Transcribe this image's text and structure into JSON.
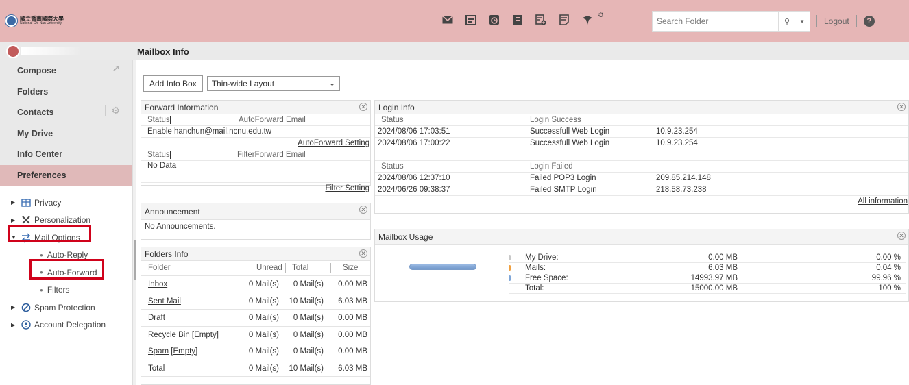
{
  "brand": {
    "logo_text_zh": "國立暨南國際大學",
    "logo_text_en": "National Chi Nan University"
  },
  "header": {
    "icons": [
      "mail-icon",
      "calendar-icon",
      "clock-icon",
      "address-book-icon",
      "add-note-icon",
      "notes-icon",
      "pin-icon",
      "settings-icon"
    ],
    "search_placeholder": "Search Folder",
    "logout_label": "Logout",
    "help_label": "?"
  },
  "page_title": "Mailbox Info",
  "sidebar": {
    "nav": [
      {
        "label": "Compose"
      },
      {
        "label": "Folders"
      },
      {
        "label": "Contacts"
      },
      {
        "label": "My Drive"
      },
      {
        "label": "Info Center"
      },
      {
        "label": "Preferences"
      }
    ],
    "tree": [
      {
        "label": "Privacy"
      },
      {
        "label": "Personalization"
      },
      {
        "label": "Mail Options"
      },
      {
        "label": "Spam Protection"
      },
      {
        "label": "Account Delegation"
      }
    ],
    "mail_options_sub": [
      "Auto-Reply",
      "Auto-Forward",
      "Filters"
    ]
  },
  "toolbar": {
    "add_info_box": "Add Info Box",
    "layout_value": "Thin-wide Layout"
  },
  "forward_info": {
    "title": "Forward Information",
    "status_label": "Status",
    "autoforward_header": "AutoForward Email",
    "autoforward_value": "Enable hanchun@mail.ncnu.edu.tw",
    "autoforward_setting": "AutoForward Setting",
    "filterforward_header": "FilterForward Email",
    "filter_value": "No Data",
    "filter_setting": "Filter Setting"
  },
  "announcement": {
    "title": "Announcement",
    "body": "No Announcements."
  },
  "folders_info": {
    "title": "Folders Info",
    "headers": {
      "folder": "Folder",
      "unread": "Unread",
      "total": "Total",
      "size": "Size"
    },
    "rows": [
      {
        "name": "Inbox",
        "empty": "",
        "unread": "0 Mail(s)",
        "total": "0 Mail(s)",
        "size": "0.00 MB",
        "link": true
      },
      {
        "name": "Sent Mail",
        "empty": "",
        "unread": "0 Mail(s)",
        "total": "10 Mail(s)",
        "size": "6.03 MB",
        "link": true
      },
      {
        "name": "Draft",
        "empty": "",
        "unread": "0 Mail(s)",
        "total": "0 Mail(s)",
        "size": "0.00 MB",
        "link": true
      },
      {
        "name": "Recycle Bin",
        "empty": "[Empty]",
        "unread": "0 Mail(s)",
        "total": "0 Mail(s)",
        "size": "0.00 MB",
        "link": true
      },
      {
        "name": "Spam",
        "empty": "[Empty]",
        "unread": "0 Mail(s)",
        "total": "0 Mail(s)",
        "size": "0.00 MB",
        "link": true
      },
      {
        "name": "Total",
        "empty": "",
        "unread": "0 Mail(s)",
        "total": "10 Mail(s)",
        "size": "6.03 MB",
        "link": false
      }
    ]
  },
  "login_info": {
    "title": "Login Info",
    "status_label": "Status",
    "success_header": "Login Success",
    "success_rows": [
      {
        "time": "2024/08/06 17:03:51",
        "type": "Successfull Web Login",
        "ip": "10.9.23.254"
      },
      {
        "time": "2024/08/06 17:00:22",
        "type": "Successfull Web Login",
        "ip": "10.9.23.254"
      }
    ],
    "failed_header": "Login Failed",
    "failed_rows": [
      {
        "time": "2024/08/06 12:37:10",
        "type": "Failed POP3 Login",
        "ip": "209.85.214.148"
      },
      {
        "time": "2024/06/26 09:38:37",
        "type": "Failed SMTP Login",
        "ip": "218.58.73.238"
      }
    ],
    "all_information": "All information"
  },
  "mailbox_usage": {
    "title": "Mailbox Usage",
    "rows": [
      {
        "label": "My Drive:",
        "size": "0.00 MB",
        "pct": "0.00 %",
        "color": "#c8c8c8"
      },
      {
        "label": "Mails:",
        "size": "6.03 MB",
        "pct": "0.04 %",
        "color": "#f0a040"
      },
      {
        "label": "Free Space:",
        "size": "14993.97 MB",
        "pct": "99.96 %",
        "color": "#7fa6d8"
      },
      {
        "label": "Total:",
        "size": "15000.00 MB",
        "pct": "100 %",
        "color": ""
      }
    ]
  }
}
